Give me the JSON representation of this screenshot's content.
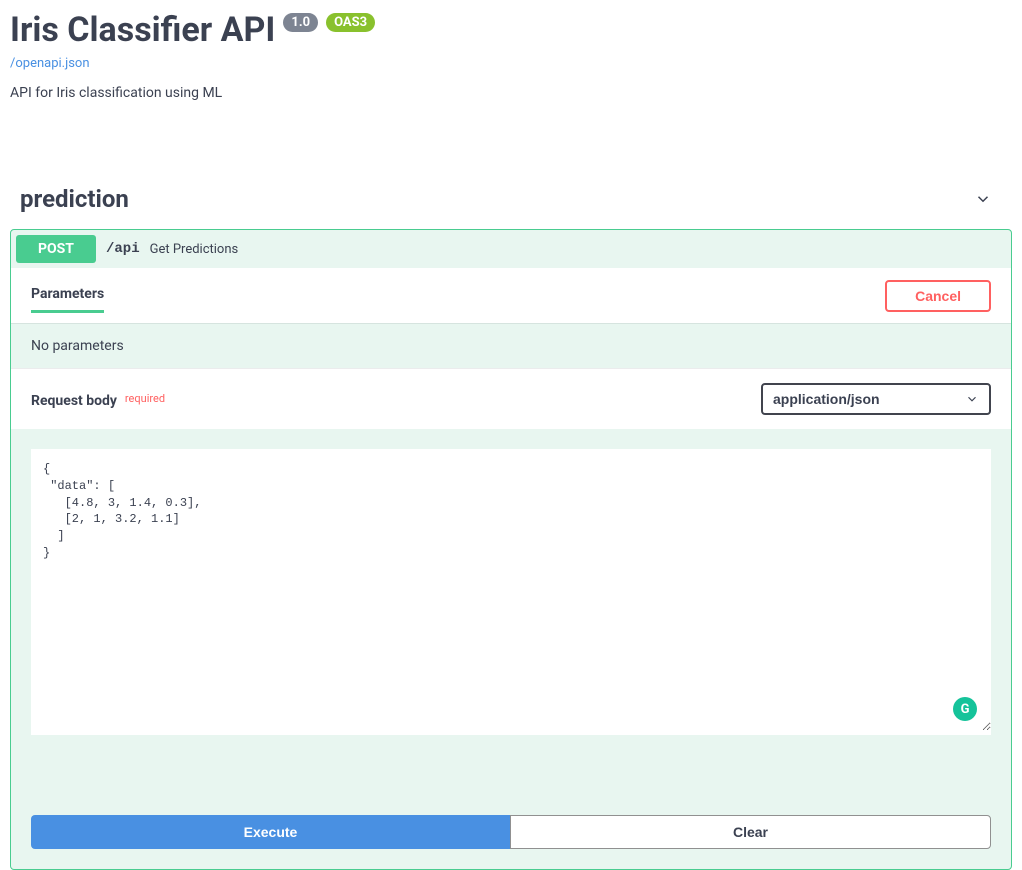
{
  "header": {
    "title": "Iris Classifier API",
    "version": "1.0",
    "oas": "OAS3",
    "spec_link": "/openapi.json",
    "description": "API for Iris classification using ML"
  },
  "section": {
    "name": "prediction"
  },
  "operation": {
    "method": "POST",
    "path": "/api",
    "summary": "Get Predictions"
  },
  "parameters": {
    "tab_label": "Parameters",
    "cancel_label": "Cancel",
    "empty_text": "No parameters"
  },
  "request_body": {
    "label": "Request body",
    "required_label": "required",
    "content_type": "application/json",
    "example": "{\n \"data\": [\n   [4.8, 3, 1.4, 0.3],\n   [2, 1, 3.2, 1.1]\n  ]\n}"
  },
  "actions": {
    "execute_label": "Execute",
    "clear_label": "Clear"
  },
  "grammarly_glyph": "G"
}
